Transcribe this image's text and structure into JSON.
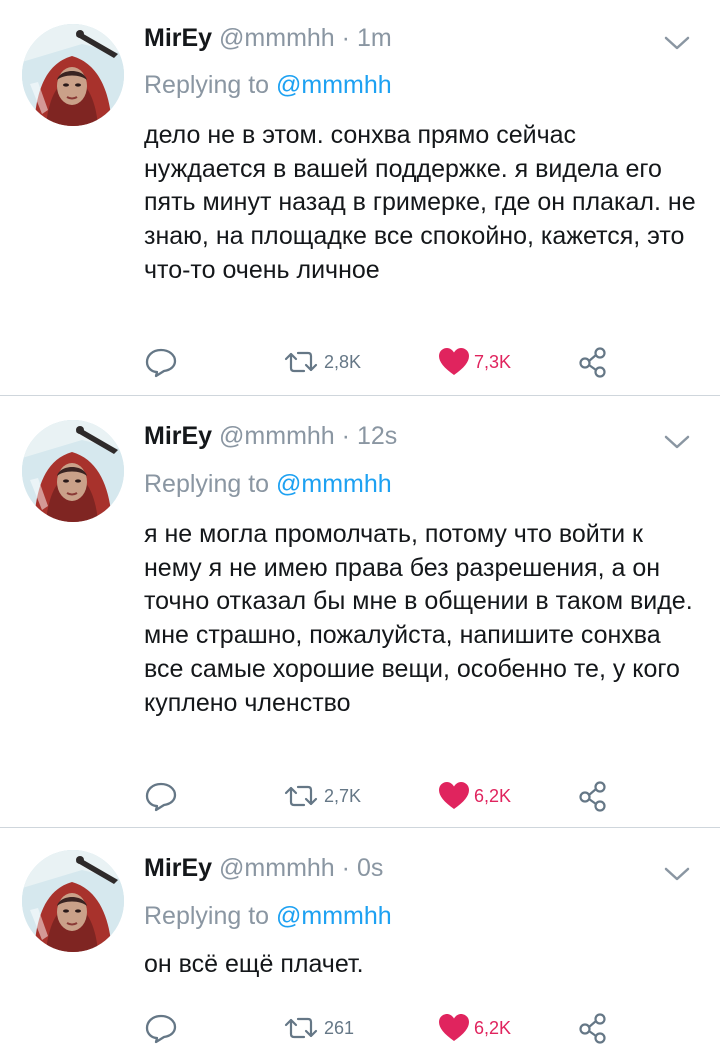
{
  "tweets": [
    {
      "name": "MirEy",
      "handle": "@mmmhh",
      "separator": "·",
      "time": "1m",
      "replying_prefix": "Replying to",
      "replying_mention": "@mmmhh",
      "text": "дело не в этом. сонхва прямо сейчас нуждается в вашей поддержке. я видела его пять минут назад в гримерке, где он плакал. не знаю, на площадке все спокойно, кажется, это что-то очень личное",
      "retweets": "2,8K",
      "likes": "7,3K"
    },
    {
      "name": "MirEy",
      "handle": "@mmmhh",
      "separator": "·",
      "time": "12s",
      "replying_prefix": "Replying to",
      "replying_mention": "@mmmhh",
      "text": "я не могла промолчать, потому что войти к нему я не имею права без разрешения, а он точно отказал бы мне в общении в таком виде. мне страшно, пожалуйста, напишите сонхва все самые хорошие вещи, особенно те, у кого куплено членство",
      "retweets": "2,7K",
      "likes": "6,2K"
    },
    {
      "name": "MirEy",
      "handle": "@mmmhh",
      "separator": "·",
      "time": "0s",
      "replying_prefix": "Replying to",
      "replying_mention": "@mmmhh",
      "text": "он всё ещё плачет.",
      "retweets": "261",
      "likes": "6,2K"
    }
  ],
  "icons": {
    "reply": "reply-icon",
    "retweet": "retweet-icon",
    "like": "heart-filled-icon",
    "share": "share-icon",
    "more": "chevron-down-icon"
  },
  "colors": {
    "like": "#e0245e",
    "mention": "#1da1f2",
    "muted": "#8a96a2"
  }
}
